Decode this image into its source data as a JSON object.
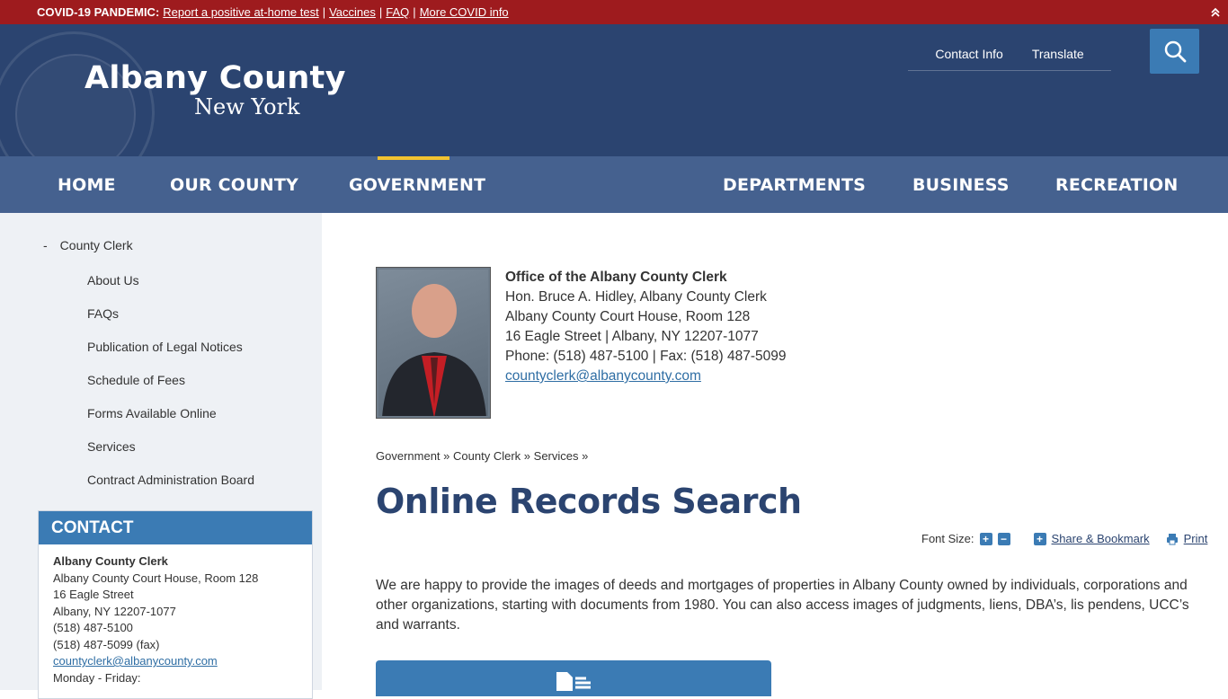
{
  "alert": {
    "label": "COVID-19 PANDEMIC:",
    "links": [
      "Report a positive at-home test",
      "Vaccines",
      "FAQ ",
      "More COVID info"
    ]
  },
  "header": {
    "title": "Albany County",
    "subtitle": "New York",
    "contact_info": "Contact Info",
    "translate": "Translate"
  },
  "nav": {
    "items": [
      "HOME",
      "OUR COUNTY",
      "GOVERNMENT",
      "DEPARTMENTS",
      "BUSINESS",
      "RECREATION"
    ]
  },
  "sidebar": {
    "parent": "County Clerk",
    "items": [
      "About Us",
      "FAQs",
      "Publication of Legal Notices",
      "Schedule of Fees",
      "Forms Available Online",
      "Services",
      "Contract Administration Board"
    ]
  },
  "contact": {
    "heading": "CONTACT",
    "name": "Albany County Clerk",
    "lines": [
      "Albany County Court House, Room 128",
      "16 Eagle Street",
      "Albany, NY 12207-1077",
      "(518) 487-5100",
      "(518) 487-5099 (fax)"
    ],
    "email": "countyclerk@albanycounty.com",
    "hours": "Monday - Friday:"
  },
  "office": {
    "title": "Office of the Albany County Clerk",
    "lines": [
      "Hon. Bruce A. Hidley, Albany County Clerk",
      "Albany County Court House, Room 128",
      "16 Eagle Street | Albany, NY 12207-1077",
      "Phone: (518) 487-5100 | Fax: (518) 487-5099"
    ],
    "email": "countyclerk@albanycounty.com"
  },
  "breadcrumb": [
    "Government",
    "County Clerk",
    "Services"
  ],
  "breadcrumb_sep": "»",
  "page": {
    "title": "Online Records Search",
    "font_size_label": "Font Size:",
    "share": "Share & Bookmark",
    "print": "Print",
    "intro": "We are happy to provide the images of deeds and mortgages of properties in Albany County owned by individuals, corporations and other organizations, starting with documents from 1980. You can also access images of judgments, liens, DBA’s, lis pendens, UCC’s and warrants."
  },
  "colors": {
    "alert_red": "#9e1b1e",
    "header_navy": "#2b4470",
    "nav_blue": "#45618f",
    "accent_blue": "#3b7bb4",
    "active_gold": "#f2c230"
  }
}
